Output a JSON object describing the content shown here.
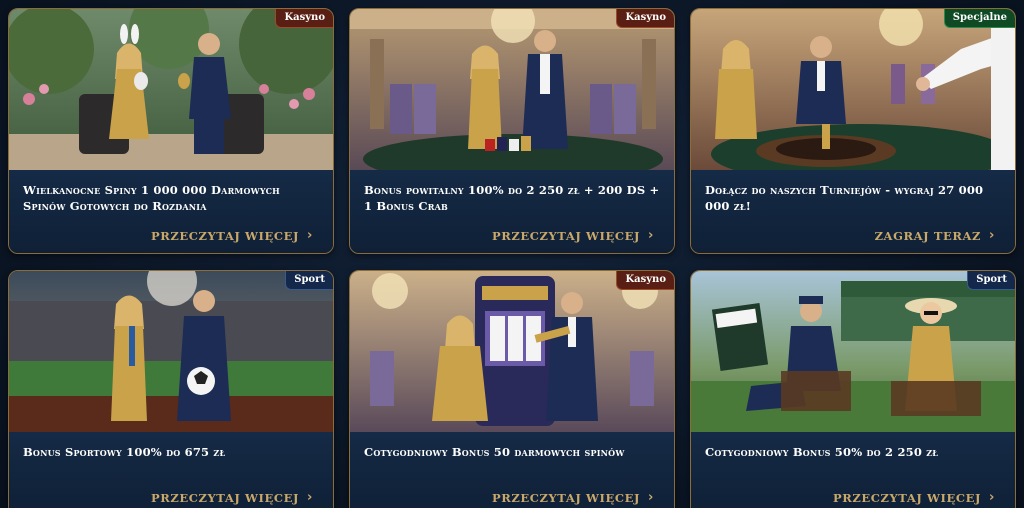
{
  "promotions": [
    {
      "badge": "Kasyno",
      "title": "Wielkanocne Spiny 1 000 000 Darmowych Spinów Gotowych do Rozdania",
      "cta": "PRZECZYTAJ WIĘCEJ"
    },
    {
      "badge": "Kasyno",
      "title": "Bonus powitalny 100% do 2 250 zł + 200 DS + 1 Bonus Crab",
      "cta": "PRZECZYTAJ WIĘCEJ"
    },
    {
      "badge": "Specjalne",
      "title": "Dołącz do naszych Turniejów - wygraj 27 000 000 zł!",
      "cta": "ZAGRAJ TERAZ"
    },
    {
      "badge": "Sport",
      "title": "Bonus Sportowy 100% do 675 zł",
      "cta": "PRZECZYTAJ WIĘCEJ"
    },
    {
      "badge": "Kasyno",
      "title": "Cotygodniowy Bonus 50 darmowych spinów",
      "cta": "PRZECZYTAJ WIĘCEJ"
    },
    {
      "badge": "Sport",
      "title": "Cotygodniowy Bonus 50% do 2 250 zł",
      "cta": "PRZECZYTAJ WIĘCEJ"
    }
  ],
  "icons": {
    "cta_icon": "chevron-right-icon"
  },
  "colors": {
    "card_border": "#8a6d3b",
    "cta_gold": "#c9a86a",
    "kasyno_badge": "#5a1f14",
    "specjalne_badge": "#0f4a24",
    "sport_badge": "#13284a"
  }
}
